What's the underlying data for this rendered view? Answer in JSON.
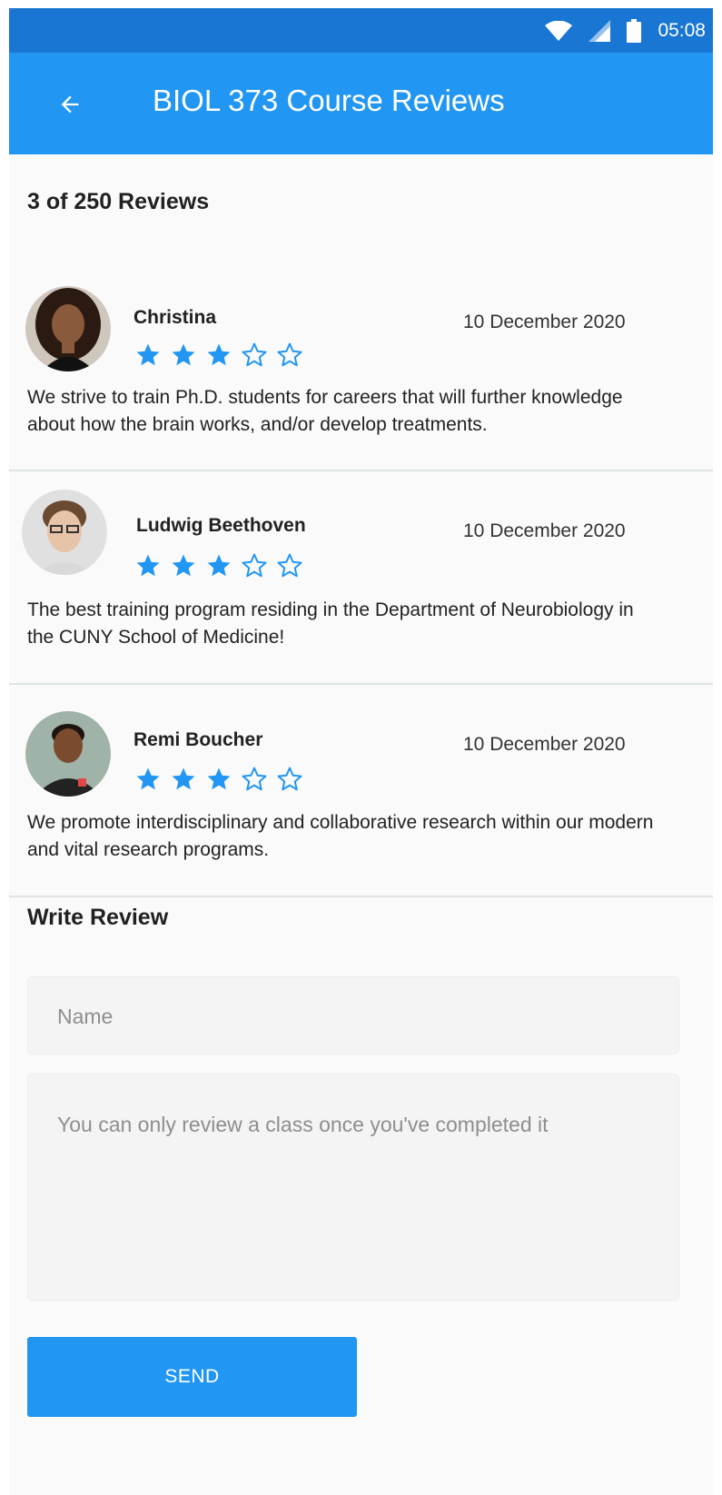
{
  "status_bar": {
    "time": "05:08",
    "icons": [
      "wifi-icon",
      "signal-icon",
      "battery-icon"
    ]
  },
  "app_bar": {
    "title": "BIOL 373 Course Reviews",
    "back_icon": "arrow-left-icon"
  },
  "reviews_summary": {
    "heading": "3 of 250 Reviews"
  },
  "reviews": [
    {
      "name": "Christina",
      "date": "10 December 2020",
      "rating": 3,
      "max_rating": 5,
      "text": "We strive to train Ph.D. students for careers that will further knowledge about how the brain works, and/or develop treatments."
    },
    {
      "name": "Ludwig Beethoven",
      "date": "10 December 2020",
      "rating": 3,
      "max_rating": 5,
      "text": "The best training program residing in the Department of Neurobiology in the CUNY School of Medicine!"
    },
    {
      "name": "Remi Boucher",
      "date": "10 December 2020",
      "rating": 3,
      "max_rating": 5,
      "text": "We promote interdisciplinary and collaborative research within our modern and vital research programs."
    }
  ],
  "write_review": {
    "heading": "Write Review",
    "name_placeholder": "Name",
    "review_placeholder": "You can only review a class once you've completed it",
    "send_label": "SEND"
  },
  "colors": {
    "primary": "#2196f3",
    "primary_dark": "#1976d2",
    "star": "#2196f3"
  }
}
